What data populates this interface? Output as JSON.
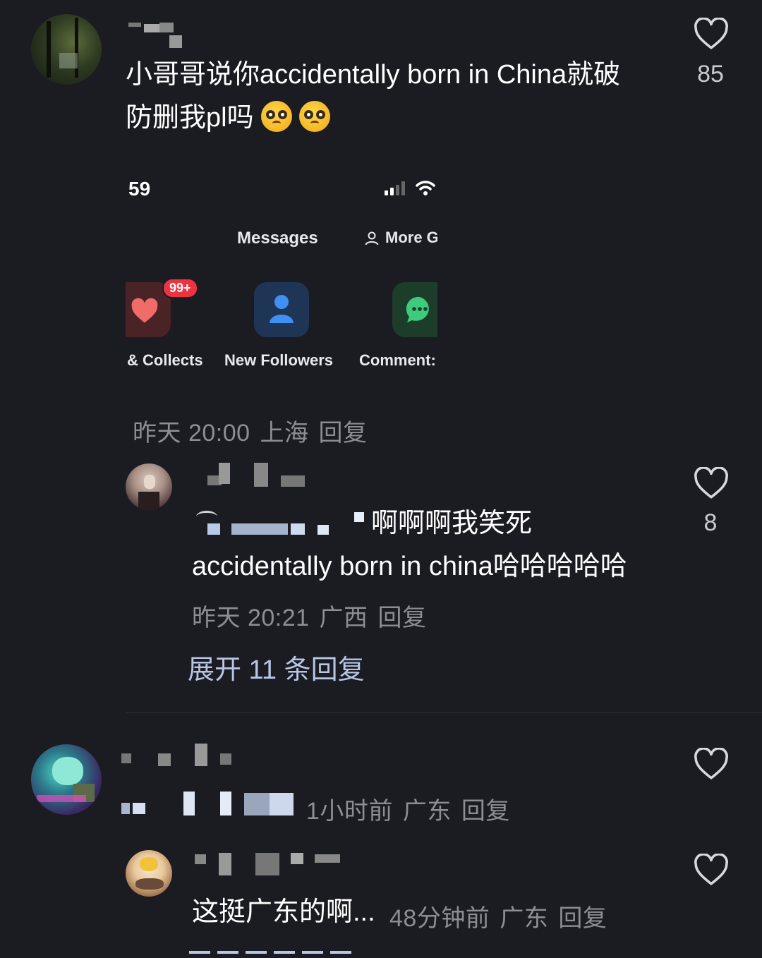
{
  "comments": [
    {
      "text_line1": "小哥哥说你accidentally born in China就破",
      "text_line2": "防删我pl吗",
      "likes": "85",
      "like_icon": "heart-outline-icon"
    },
    {
      "text_line1": "啊啊啊我笑死",
      "text_line2": "accidentally born in china哈哈哈哈哈",
      "time": "昨天 20:21",
      "location": "广西",
      "reply": "回复",
      "likes": "8",
      "expand": "展开 11 条回复"
    },
    {
      "time": "1小时前",
      "location": "广东",
      "reply": "回复"
    },
    {
      "text": "这挺广东的啊...",
      "time": "48分钟前",
      "location": "广东",
      "reply": "回复"
    }
  ],
  "first_meta": {
    "time": "昨天 20:00",
    "location": "上海",
    "reply": "回复"
  },
  "embedded_screenshot": {
    "status_time": "59",
    "title": "Messages",
    "more": "More G",
    "tiles": [
      {
        "label": "& Collects",
        "badge": "99+",
        "icon": "heart-icon",
        "color": "#f26b6b"
      },
      {
        "label": "New Followers",
        "icon": "person-icon",
        "color": "#3f8ff5"
      },
      {
        "label": "Comment:",
        "icon": "chat-bubble-icon",
        "color": "#3fcb7d"
      }
    ]
  }
}
